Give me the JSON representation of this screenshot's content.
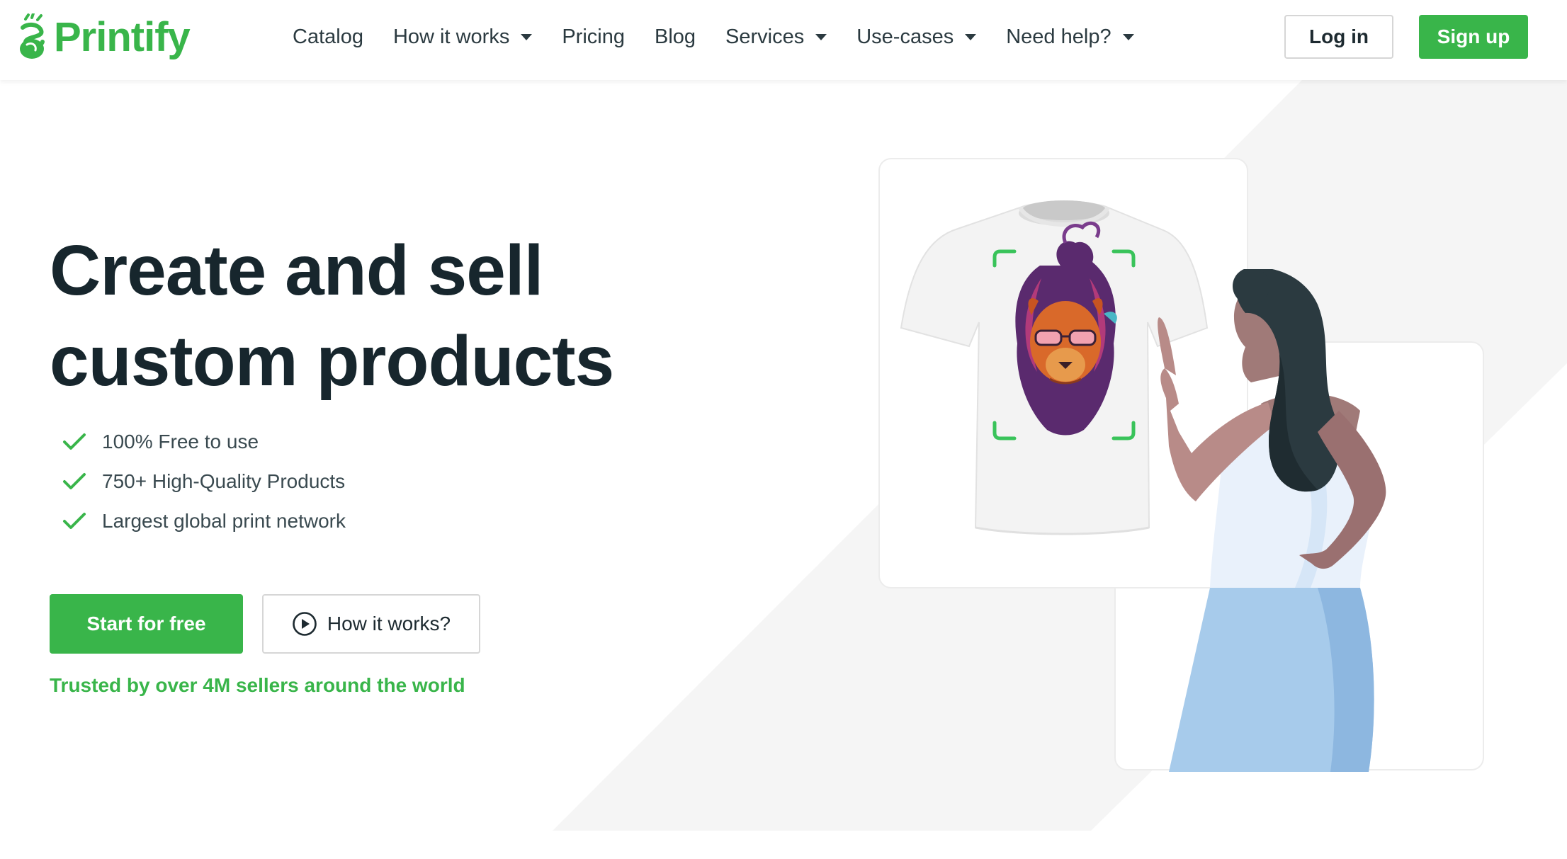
{
  "brand": {
    "name": "Printify",
    "accent": "#39b54a",
    "dark": "#17262d"
  },
  "nav": {
    "items": [
      {
        "label": "Catalog",
        "has_dropdown": false
      },
      {
        "label": "How it works",
        "has_dropdown": true
      },
      {
        "label": "Pricing",
        "has_dropdown": false
      },
      {
        "label": "Blog",
        "has_dropdown": false
      },
      {
        "label": "Services",
        "has_dropdown": true
      },
      {
        "label": "Use-cases",
        "has_dropdown": true
      },
      {
        "label": "Need help?",
        "has_dropdown": true
      }
    ],
    "login_label": "Log in",
    "signup_label": "Sign up"
  },
  "hero": {
    "title_line1": "Create and sell",
    "title_line2": "custom products",
    "features": [
      "100% Free to use",
      "750+ High-Quality Products",
      "Largest global print network"
    ],
    "cta_primary": "Start for free",
    "cta_secondary": "How it works?",
    "trusted_text": "Trusted by over 4M sellers around the world"
  },
  "icons": {
    "logo": "printify-logo-icon",
    "check": "check-icon",
    "play": "play-circle-icon",
    "caret": "chevron-down-icon"
  }
}
